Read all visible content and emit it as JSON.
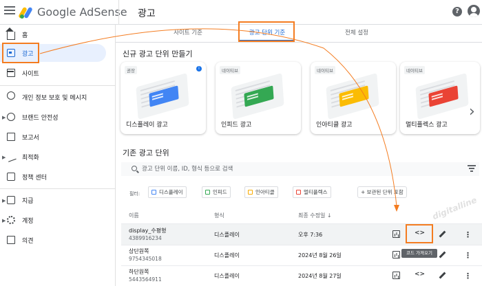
{
  "header": {
    "logo_text": "Google AdSense",
    "page_title": "광고",
    "help_symbol": "?"
  },
  "sidebar": {
    "items": [
      {
        "label": "홈",
        "icon": "home-icon"
      },
      {
        "label": "광고",
        "icon": "ads-icon",
        "active": true
      },
      {
        "label": "사이트",
        "icon": "site-icon"
      },
      {
        "label": "개인 정보 보호 및 메시지",
        "icon": "privacy-icon"
      },
      {
        "label": "브랜드 안전성",
        "icon": "brand-safety-icon"
      },
      {
        "label": "보고서",
        "icon": "report-icon"
      },
      {
        "label": "최적화",
        "icon": "optimize-icon"
      },
      {
        "label": "정책 센터",
        "icon": "policy-icon"
      },
      {
        "label": "지급",
        "icon": "payments-icon"
      },
      {
        "label": "계정",
        "icon": "gear-icon"
      },
      {
        "label": "의견",
        "icon": "feedback-icon"
      }
    ]
  },
  "tabs": [
    {
      "label": "사이트 기준"
    },
    {
      "label": "광고 단위 기준",
      "active": true
    },
    {
      "label": "전체 설정"
    }
  ],
  "create_section": {
    "title": "신규 광고 단위 만들기",
    "cards": [
      {
        "tag": "권장",
        "label": "디스플레이 광고",
        "color": "#4285f4",
        "info": "i"
      },
      {
        "tag": "네이티브",
        "label": "인피드 광고",
        "color": "#34a853"
      },
      {
        "tag": "네이티브",
        "label": "인아티클 광고",
        "color": "#fbbc04"
      },
      {
        "tag": "네이티브",
        "label": "멀티플렉스 광고",
        "color": "#ea4335"
      }
    ],
    "next_arrow": "›"
  },
  "existing": {
    "title": "기존 광고 단위",
    "search_placeholder": "광고 단위 이름, ID, 형식 등으로 검색",
    "filter_label": "필터:",
    "chips": [
      {
        "label": "디스플레이",
        "color": "#4285f4"
      },
      {
        "label": "인피드",
        "color": "#34a853"
      },
      {
        "label": "인아티클",
        "color": "#f9ab00"
      },
      {
        "label": "멀티플렉스",
        "color": "#ea4335"
      }
    ],
    "include_archived": "+ 보관된 단위 포함",
    "columns": {
      "name": "이름",
      "type": "형식",
      "modified": "최종 수정일 ↓"
    },
    "rows": [
      {
        "name": "display_수평형",
        "id": "4389916234",
        "type": "디스플레이",
        "modified": "오후 7:36"
      },
      {
        "name": "상단원쪽",
        "id": "9754345018",
        "type": "디스플레이",
        "modified": "2024년 8월 26일"
      },
      {
        "name": "하단원쪽",
        "id": "5443564911",
        "type": "디스플레이",
        "modified": "2024년 8월 27일"
      }
    ],
    "code_symbol": "<>",
    "more_symbol": "⋮",
    "tooltip": "코드 가져오기"
  },
  "watermark": "digitalline",
  "accent_color": "#1967d2",
  "highlight_color": "#f47c20"
}
